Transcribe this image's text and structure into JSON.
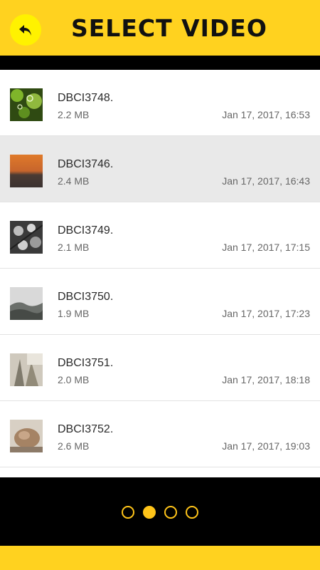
{
  "header": {
    "title": "SELECT VIDEO",
    "back_icon": "back-arrow-icon",
    "accent_color": "#ffd21f"
  },
  "videos": [
    {
      "name": "DBCI3748.",
      "size": "2.2 MB",
      "date": "Jan 17, 2017, 16:53",
      "selected": false
    },
    {
      "name": "DBCI3746.",
      "size": "2.4 MB",
      "date": "Jan 17, 2017, 16:43",
      "selected": true
    },
    {
      "name": "DBCI3749.",
      "size": "2.1 MB",
      "date": "Jan 17, 2017, 17:15",
      "selected": false
    },
    {
      "name": "DBCI3750.",
      "size": "1.9 MB",
      "date": "Jan 17, 2017, 17:23",
      "selected": false
    },
    {
      "name": "DBCI3751.",
      "size": "2.0 MB",
      "date": "Jan 17, 2017, 18:18",
      "selected": false
    },
    {
      "name": "DBCI3752.",
      "size": "2.6 MB",
      "date": "Jan 17, 2017, 19:03",
      "selected": false
    }
  ],
  "pager": {
    "count": 4,
    "active_index": 1
  }
}
